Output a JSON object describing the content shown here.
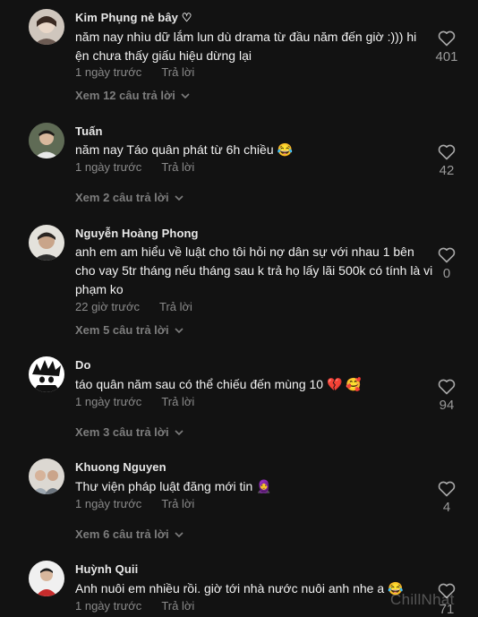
{
  "comments": [
    {
      "author": "Kim Phụng nè bây ♡",
      "text": "năm nay nhìu dữ lắm lun dù drama từ đầu năm đến giờ :))) hi ện chưa thấy giấu hiệu dừng lại",
      "time": "1 ngày trước",
      "reply": "Trả lời",
      "view_replies": "Xem 12 câu trả lời",
      "likes": "401"
    },
    {
      "author": "Tuấn",
      "text": "năm nay Táo quân phát từ 6h chiều 😂",
      "time": "1 ngày trước",
      "reply": "Trả lời",
      "view_replies": "Xem 2 câu trả lời",
      "likes": "42"
    },
    {
      "author": "Nguyễn Hoàng Phong",
      "text": "anh em am hiểu về luật cho tôi hỏi nợ dân sự với nhau 1 bên cho vay 5tr tháng nếu tháng sau k trả họ lấy lãi 500k có tính là vi phạm ko",
      "time": "22 giờ trước",
      "reply": "Trả lời",
      "view_replies": "Xem 5 câu trả lời",
      "likes": "0"
    },
    {
      "author": "Do",
      "text": "táo quân năm sau có thể chiếu đến mùng 10 💔 🥰",
      "time": "1 ngày trước",
      "reply": "Trả lời",
      "view_replies": "Xem 3 câu trả lời",
      "likes": "94"
    },
    {
      "author": "Khuong Nguyen",
      "text": "Thư viện pháp luật đăng mới tin 🧕",
      "time": "1 ngày trước",
      "reply": "Trả lời",
      "view_replies": "Xem 6 câu trả lời",
      "likes": "4"
    },
    {
      "author": "Huỳnh Quii",
      "text": "Anh nuôi em nhiều rồi. giờ tới nhà nước nuôi anh nhe a 😂",
      "time": "1 ngày trước",
      "reply": "Trả lời",
      "view_replies": "",
      "likes": "71"
    }
  ],
  "icons": {
    "like": "heart-outline-icon",
    "expand": "chevron-down-icon"
  },
  "watermark": "ChillNhat",
  "colors": {
    "background": "#121212",
    "author": "#e8e8e8",
    "meta": "#8a8a8a"
  }
}
